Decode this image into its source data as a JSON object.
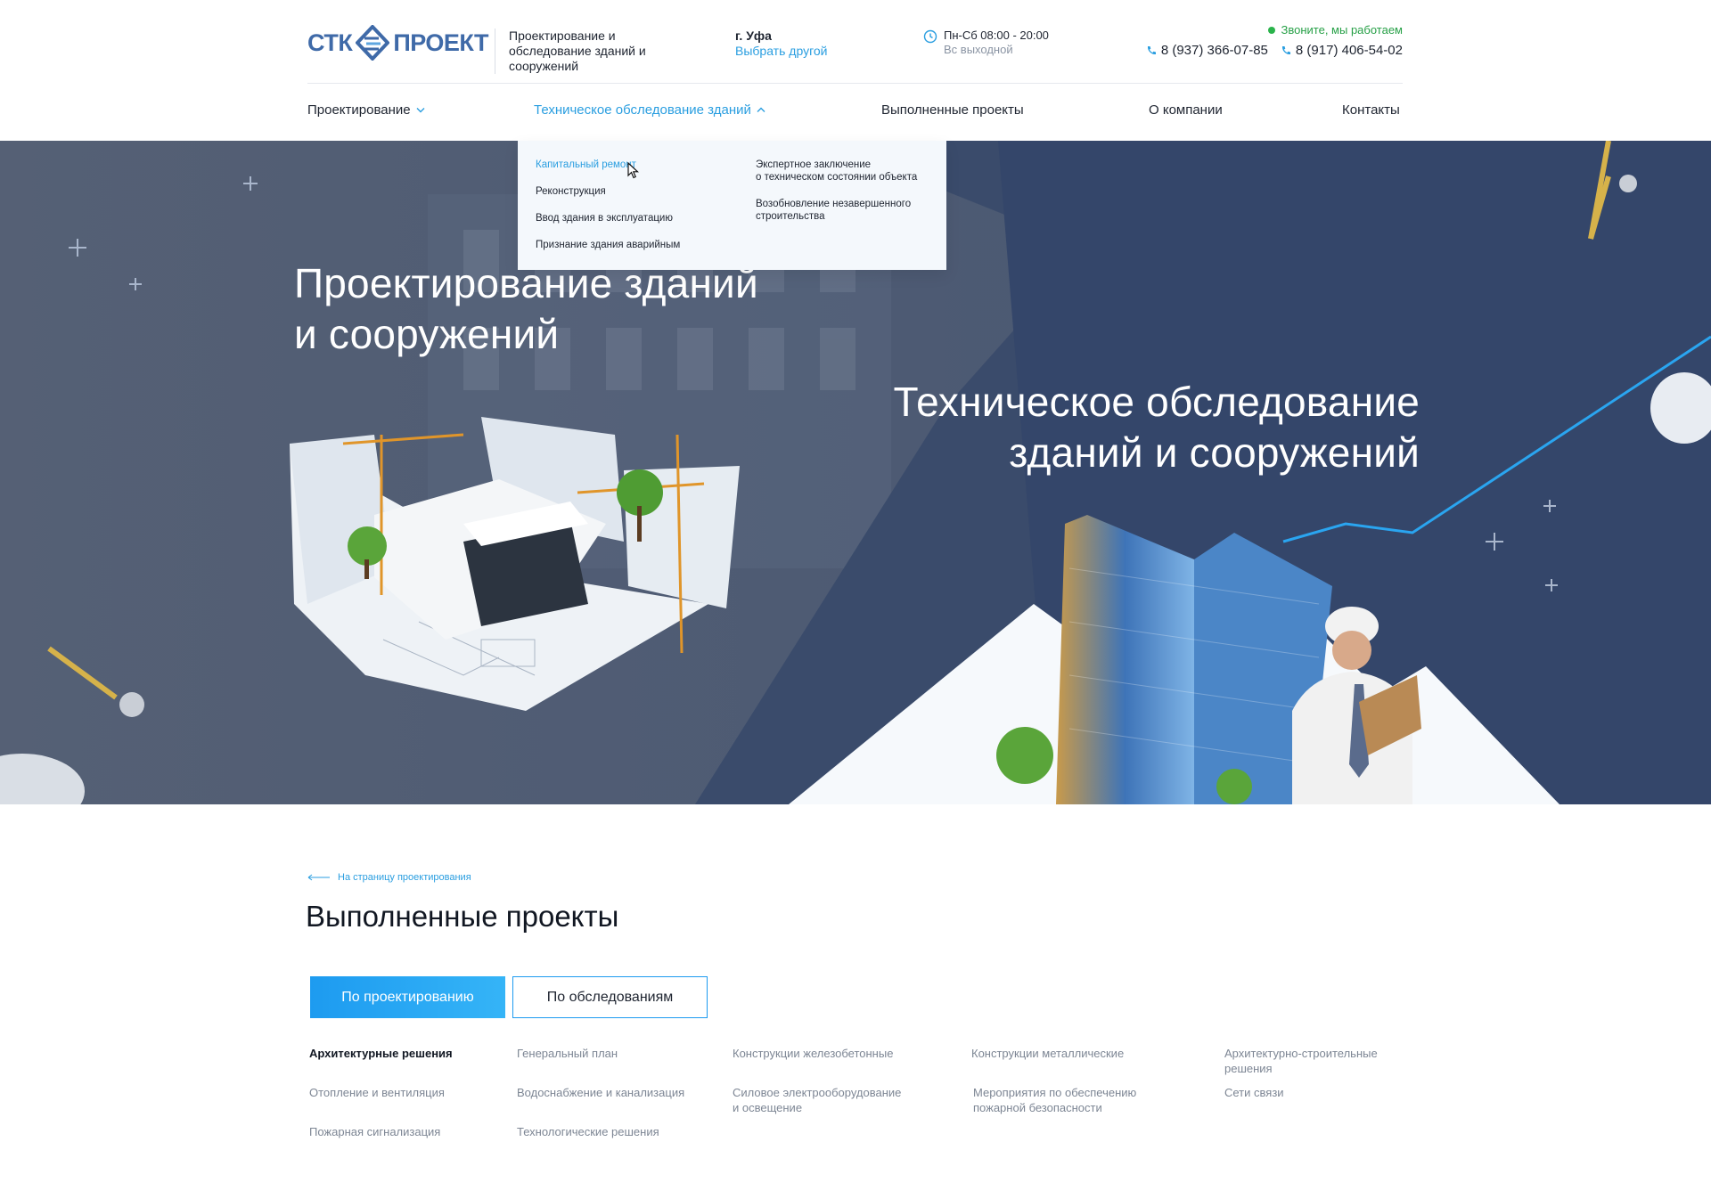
{
  "header": {
    "logo": {
      "left": "СТК",
      "right": "ПРОЕКТ"
    },
    "tagline": "Проектирование и обследование зданий и сооружений",
    "city": {
      "name": "г. Уфа",
      "change_link": "Выбрать другой"
    },
    "hours": {
      "weekdays": "Пн-Сб 08:00 - 20:00",
      "sunday": "Вс выходной"
    },
    "status": "Звоните, мы работаем",
    "phones": [
      "8 (937) 366-07-85",
      "8 (917) 406-54-02"
    ],
    "icons": [
      "clock-icon",
      "phone-icon"
    ]
  },
  "nav": {
    "items": [
      {
        "label": "Проектирование",
        "has_dropdown": true,
        "open": false
      },
      {
        "label": "Техническое обследование зданий",
        "has_dropdown": true,
        "open": true
      },
      {
        "label": "Выполненные проекты"
      },
      {
        "label": "О компании"
      },
      {
        "label": "Контакты"
      }
    ]
  },
  "dropdown": {
    "col1": [
      "Капитальный ремонт",
      "Реконструкция",
      "Ввод здания в эксплуатацию",
      "Признание здания аварийным"
    ],
    "col2": [
      "Экспертное заключение\nо техническом состоянии объекта",
      "Возобновление незавершенного\nстроительства"
    ],
    "hovered": "Капитальный ремонт"
  },
  "hero": {
    "title_left": "Проектирование зданий\nи сооружений",
    "title_right": "Техническое обследование\nзданий и сооружений"
  },
  "content": {
    "back_link": "На страницу проектирования",
    "title": "Выполненные проекты",
    "tabs": [
      "По проектированию",
      "По обследованиям"
    ],
    "active_tab": "По проектированию",
    "categories": [
      "Архитектурные решения",
      "Генеральный план",
      "Конструкции железобетонные",
      "Конструкции металлические",
      "Архитектурно-строительные\nрешения",
      "Отопление и вентиляция",
      "Водоснабжение и канализация",
      "Силовое электрооборудование\nи освещение",
      "Мероприятия по обеспечению\nпожарной безопасности",
      "Сети связи",
      "Пожарная сигнализация",
      "Технологические решения"
    ],
    "active_category": "Архитектурные решения"
  },
  "colors": {
    "accent": "#2a9ee0",
    "brand": "#3f6aa8",
    "hero": "#3f4f6e",
    "status": "#2ab34b"
  }
}
